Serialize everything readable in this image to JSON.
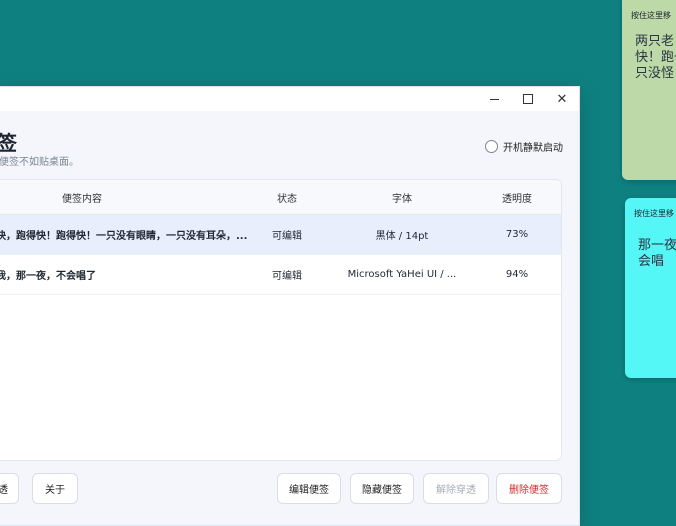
{
  "window": {
    "title": "签",
    "subtitle": "便签不如贴桌面。",
    "autostart_label": "开机静默启动"
  },
  "table": {
    "headers": {
      "content": "便签内容",
      "status": "状态",
      "font": "字体",
      "opacity": "透明度"
    },
    "rows": [
      {
        "content": "快，跑得快！跑得快！一只没有眼睛，一只没有耳朵，...",
        "status": "可编辑",
        "font": "黑体 / 14pt",
        "opacity": "73%"
      },
      {
        "content": "我，那一夜，不会唱了",
        "status": "可编辑",
        "font": "Microsoft YaHei UI / ...",
        "opacity": "94%"
      }
    ]
  },
  "footer": {
    "penetrate_label": "透",
    "about_label": "关于",
    "edit_label": "编辑便签",
    "hide_label": "隐藏便签",
    "unpenetrate_label": "解除穿透",
    "delete_label": "删除便签"
  },
  "notes": [
    {
      "drag_hint": "按住这里移",
      "text": "两只老快！跑一只没怪！",
      "color": "#bdd9a7"
    },
    {
      "drag_hint": "按住这里移",
      "text": "那一夜不会唱",
      "color": "#55f6f6"
    }
  ],
  "colors": {
    "desktop": "#0f8080",
    "delete": "#cc2e2e",
    "selected_row": "#e8eefb"
  }
}
